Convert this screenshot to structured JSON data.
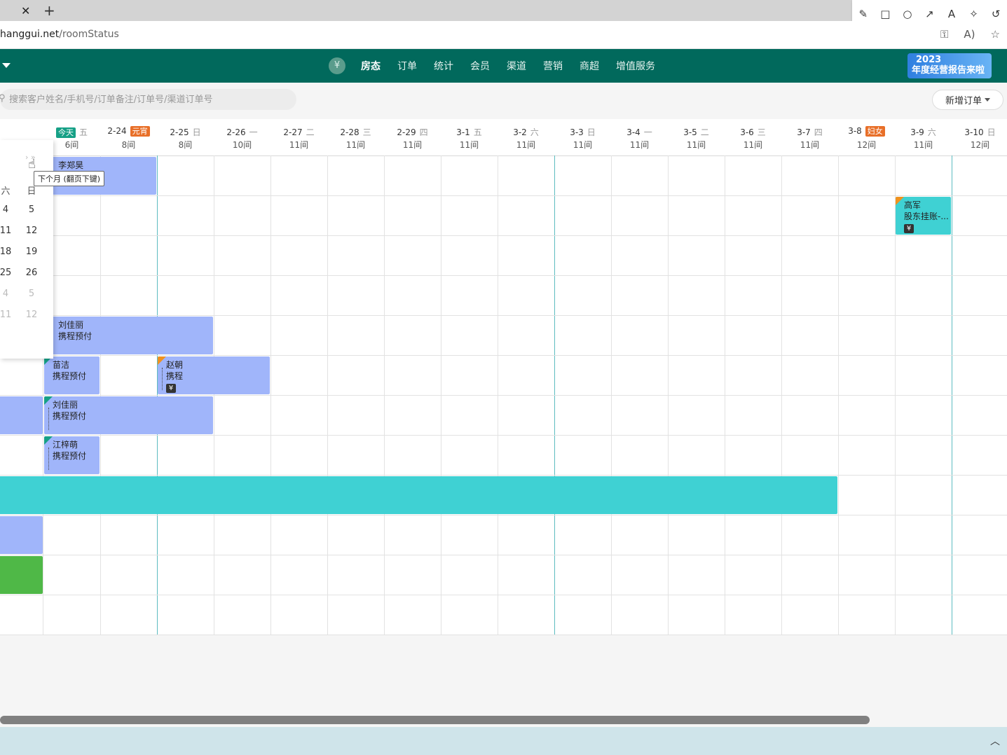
{
  "browser": {
    "tab_close": "✕",
    "tab_new": "+",
    "url_host": "hanggui.net",
    "url_path": "/roomStatus",
    "draw_tools": [
      "✎",
      "□",
      "○",
      "↗",
      "A",
      "✧",
      "↺"
    ],
    "draw_tool_names": [
      "pencil-icon",
      "rectangle-icon",
      "circle-icon",
      "arrow-icon",
      "text-icon",
      "magic-icon",
      "undo-icon"
    ],
    "addr_icons": [
      "⚿",
      "A)",
      "☆"
    ]
  },
  "nav": {
    "yen": "¥",
    "items": [
      "房态",
      "订单",
      "统计",
      "会员",
      "渠道",
      "营销",
      "商超",
      "增值服务"
    ],
    "active_index": 0,
    "banner_line1": "2023",
    "banner_line2": "年度经营报告来啦"
  },
  "search": {
    "placeholder": "搜索客户姓名/手机号/订单备注/订单号/渠道订单号"
  },
  "actions": {
    "new_order": "新增订单"
  },
  "colors": {
    "header": "#01695c",
    "booking_blue": "#a0b5fa",
    "booking_teal": "#3fd1d3",
    "booking_green": "#4fb847",
    "badge_today": "#16a086",
    "badge_holiday": "#e86f28"
  },
  "dates": [
    {
      "date": "",
      "badge": "今天",
      "badge_type": "today",
      "weekday": "五",
      "rooms": "6间"
    },
    {
      "date": "2-24",
      "badge": "元宵",
      "badge_type": "holiday",
      "weekday": "",
      "rooms": "8间"
    },
    {
      "date": "2-25",
      "badge": "",
      "badge_type": "",
      "weekday": "日",
      "rooms": "8间"
    },
    {
      "date": "2-26",
      "badge": "",
      "badge_type": "",
      "weekday": "一",
      "rooms": "10间"
    },
    {
      "date": "2-27",
      "badge": "",
      "badge_type": "",
      "weekday": "二",
      "rooms": "11间"
    },
    {
      "date": "2-28",
      "badge": "",
      "badge_type": "",
      "weekday": "三",
      "rooms": "11间"
    },
    {
      "date": "2-29",
      "badge": "",
      "badge_type": "",
      "weekday": "四",
      "rooms": "11间"
    },
    {
      "date": "3-1",
      "badge": "",
      "badge_type": "",
      "weekday": "五",
      "rooms": "11间"
    },
    {
      "date": "3-2",
      "badge": "",
      "badge_type": "",
      "weekday": "六",
      "rooms": "11间"
    },
    {
      "date": "3-3",
      "badge": "",
      "badge_type": "",
      "weekday": "日",
      "rooms": "11间"
    },
    {
      "date": "3-4",
      "badge": "",
      "badge_type": "",
      "weekday": "一",
      "rooms": "11间"
    },
    {
      "date": "3-5",
      "badge": "",
      "badge_type": "",
      "weekday": "二",
      "rooms": "11间"
    },
    {
      "date": "3-6",
      "badge": "",
      "badge_type": "",
      "weekday": "三",
      "rooms": "11间"
    },
    {
      "date": "3-7",
      "badge": "",
      "badge_type": "",
      "weekday": "四",
      "rooms": "11间"
    },
    {
      "date": "3-8",
      "badge": "妇女",
      "badge_type": "holiday",
      "weekday": "",
      "rooms": "12间"
    },
    {
      "date": "3-9",
      "badge": "",
      "badge_type": "",
      "weekday": "六",
      "rooms": "11间"
    },
    {
      "date": "3-10",
      "badge": "",
      "badge_type": "",
      "weekday": "日",
      "rooms": "12间"
    }
  ],
  "bookings": [
    {
      "row": 0,
      "start": 0.1,
      "end": 2,
      "guest": "李郑昊",
      "channel": "",
      "color": "blue",
      "corner": "",
      "yen": false,
      "dots": false
    },
    {
      "row": 1,
      "start": 15,
      "end": 16,
      "guest": "高军",
      "channel": "股东挂账-...",
      "color": "teal",
      "corner": "orange",
      "yen": true,
      "dots": false
    },
    {
      "row": 4,
      "start": 0.1,
      "end": 3,
      "guest": "刘佳丽",
      "channel": "携程预付",
      "color": "blue",
      "corner": "",
      "yen": false,
      "dots": false
    },
    {
      "row": 5,
      "start": 0,
      "end": 1,
      "guest": "苗洁",
      "channel": "携程预付",
      "color": "blue",
      "corner": "green",
      "yen": false,
      "dots": false
    },
    {
      "row": 5,
      "start": 2,
      "end": 4,
      "guest": "赵朝",
      "channel": "携程",
      "color": "blue",
      "corner": "orange",
      "yen": true,
      "dots": true
    },
    {
      "row": 6,
      "start": -1,
      "end": 0,
      "guest": "",
      "channel": "",
      "color": "blue",
      "corner": "",
      "yen": false,
      "dots": false
    },
    {
      "row": 6,
      "start": 0,
      "end": 3,
      "guest": "刘佳丽",
      "channel": "携程预付",
      "color": "blue",
      "corner": "green",
      "yen": false,
      "dots": true
    },
    {
      "row": 7,
      "start": 0,
      "end": 1,
      "guest": "江梓萌",
      "channel": "携程预付",
      "color": "blue",
      "corner": "green",
      "yen": false,
      "dots": true
    },
    {
      "row": 8,
      "start": -1,
      "end": 14,
      "guest": "",
      "channel": "",
      "color": "teal",
      "corner": "",
      "yen": false,
      "dots": false
    },
    {
      "row": 9,
      "start": -1,
      "end": 0,
      "guest": "",
      "channel": "",
      "color": "blue",
      "corner": "",
      "yen": false,
      "dots": false
    },
    {
      "row": 10,
      "start": -1,
      "end": 0,
      "guest": "",
      "channel": "",
      "color": "green",
      "corner": "",
      "yen": false,
      "dots": false
    }
  ],
  "calendar": {
    "nav_next": "› »",
    "weekday_sat": "六",
    "weekday_sun": "日",
    "rows": [
      {
        "sat": "4",
        "sun": "5",
        "dim": false
      },
      {
        "sat": "11",
        "sun": "12",
        "dim": false
      },
      {
        "sat": "18",
        "sun": "19",
        "dim": false
      },
      {
        "sat": "25",
        "sun": "26",
        "dim": false
      },
      {
        "sat": "4",
        "sun": "5",
        "dim": true
      },
      {
        "sat": "11",
        "sun": "12",
        "dim": true
      }
    ],
    "tooltip": "下个月 (翻页下键)"
  },
  "footer": {
    "collapse": "︿"
  }
}
